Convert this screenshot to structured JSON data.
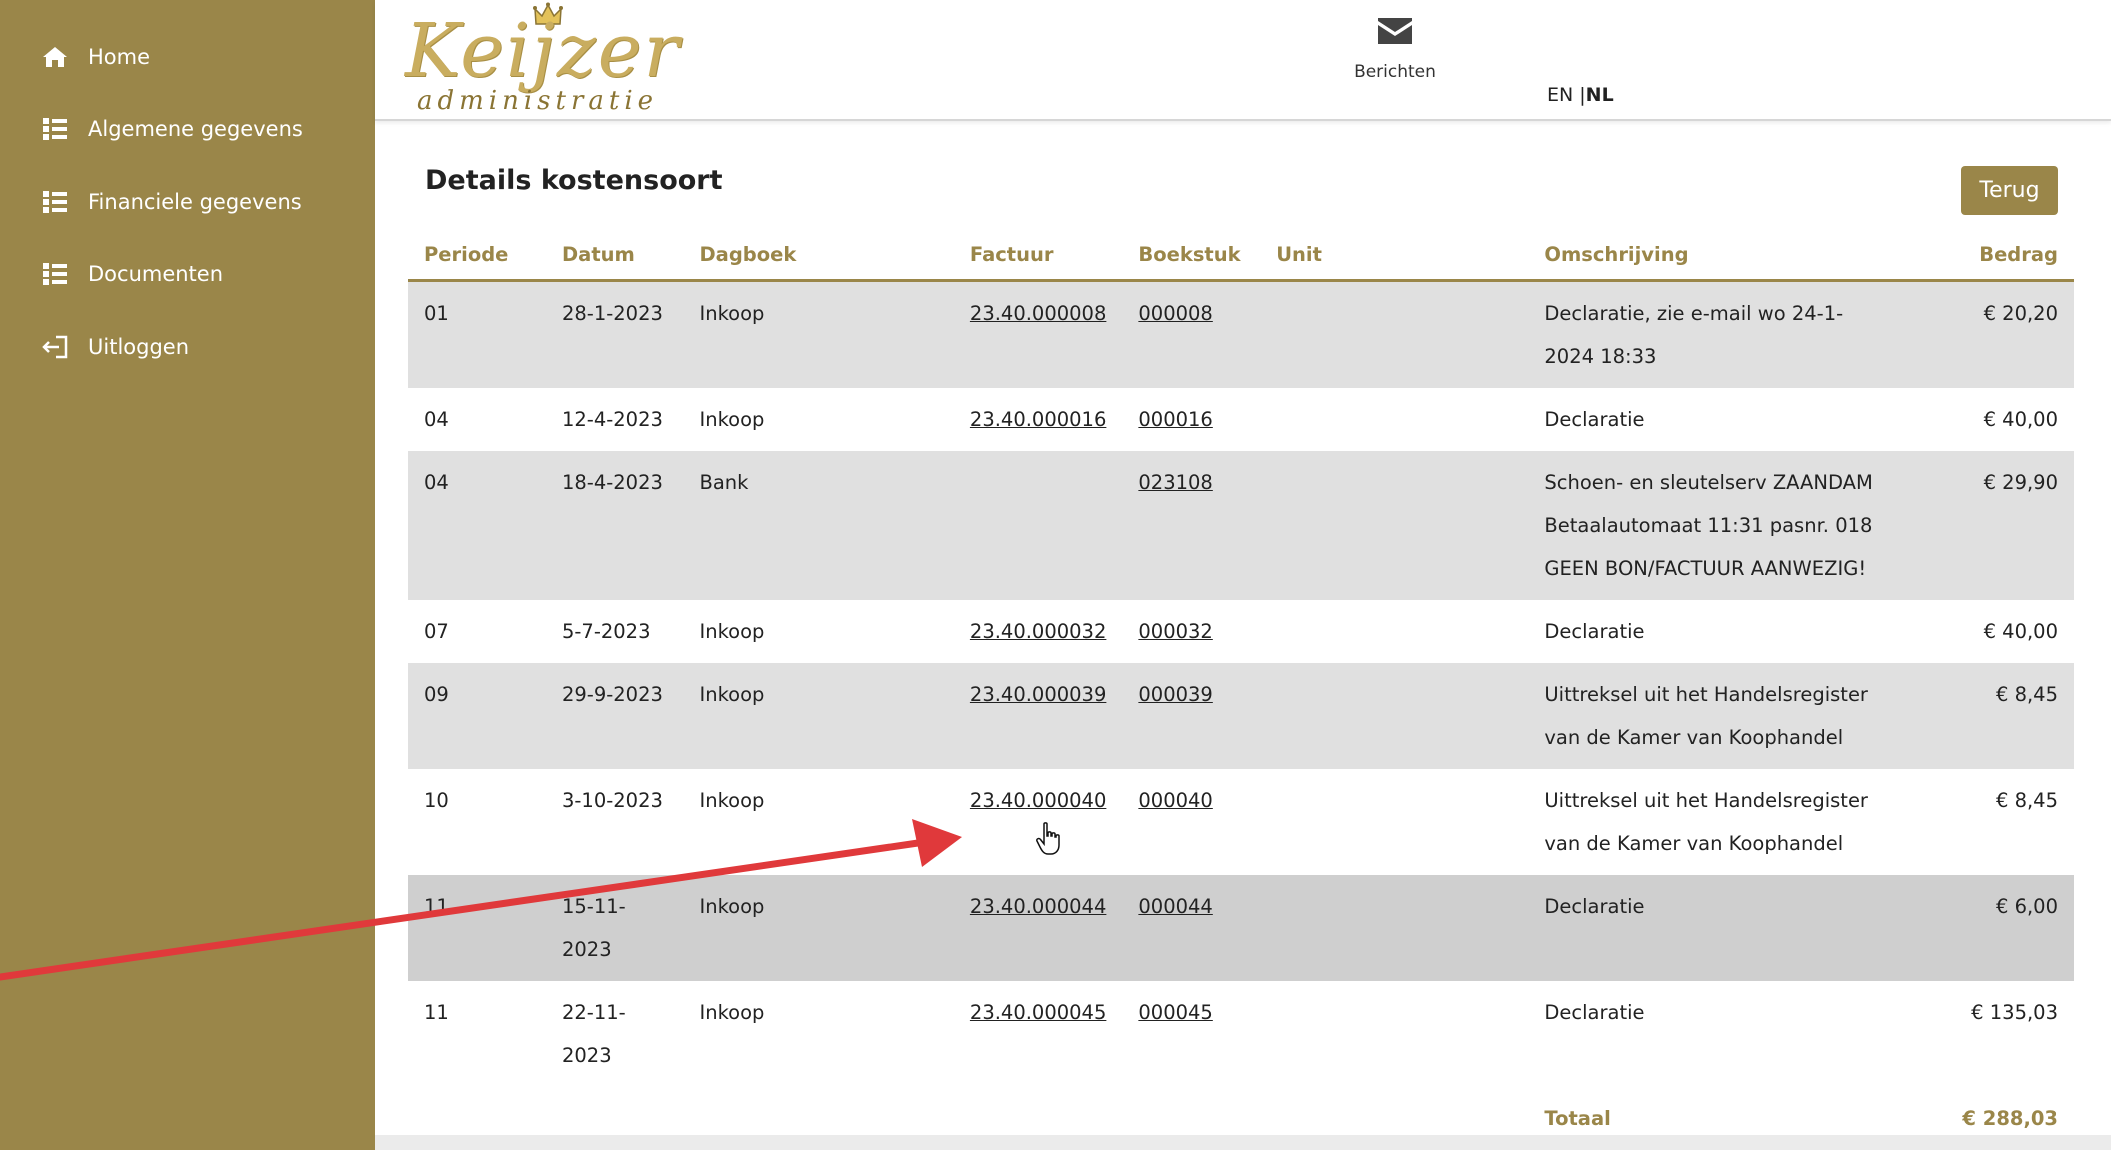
{
  "sidebar": {
    "items": [
      {
        "label": "Home",
        "icon": "home-icon"
      },
      {
        "label": "Algemene gegevens",
        "icon": "list-icon"
      },
      {
        "label": "Financiele gegevens",
        "icon": "list-icon"
      },
      {
        "label": "Documenten",
        "icon": "list-icon"
      },
      {
        "label": "Uitloggen",
        "icon": "logout-icon"
      }
    ]
  },
  "header": {
    "logo_top": "Keijzer",
    "logo_bottom": "administratie",
    "messages_label": "Berichten",
    "lang_en": "EN",
    "lang_sep": " |",
    "lang_nl": "NL"
  },
  "main": {
    "title": "Details kostensoort",
    "back_button": "Terug",
    "columns": [
      "Periode",
      "Datum",
      "Dagboek",
      "Factuur",
      "Boekstuk",
      "Unit",
      "Omschrijving",
      "Bedrag"
    ],
    "rows": [
      {
        "periode": "01",
        "datum": "28-1-2023",
        "dagboek": "Inkoop",
        "factuur": "23.40.000008",
        "boekstuk": "000008",
        "unit": "",
        "omschrijving": "Declaratie, zie e-mail wo 24-1-2024 18:33",
        "bedrag": "€ 20,20"
      },
      {
        "periode": "04",
        "datum": "12-4-2023",
        "dagboek": "Inkoop",
        "factuur": "23.40.000016",
        "boekstuk": "000016",
        "unit": "",
        "omschrijving": "Declaratie",
        "bedrag": "€ 40,00"
      },
      {
        "periode": "04",
        "datum": "18-4-2023",
        "dagboek": "Bank",
        "factuur": "",
        "boekstuk": "023108",
        "unit": "",
        "omschrijving": "Schoen- en sleutelserv ZAANDAM Betaalautomaat 11:31 pasnr. 018 GEEN BON/FACTUUR AANWEZIG!",
        "bedrag": "€ 29,90"
      },
      {
        "periode": "07",
        "datum": "5-7-2023",
        "dagboek": "Inkoop",
        "factuur": "23.40.000032",
        "boekstuk": "000032",
        "unit": "",
        "omschrijving": "Declaratie",
        "bedrag": "€ 40,00"
      },
      {
        "periode": "09",
        "datum": "29-9-2023",
        "dagboek": "Inkoop",
        "factuur": "23.40.000039",
        "boekstuk": "000039",
        "unit": "",
        "omschrijving": "Uittreksel uit het Handelsregister van de Kamer van Koophandel",
        "bedrag": "€ 8,45"
      },
      {
        "periode": "10",
        "datum": "3-10-2023",
        "dagboek": "Inkoop",
        "factuur": "23.40.000040",
        "boekstuk": "000040",
        "unit": "",
        "omschrijving": "Uittreksel uit het Handelsregister van de Kamer van Koophandel",
        "bedrag": "€ 8,45"
      },
      {
        "periode": "11",
        "datum": "15-11-2023",
        "dagboek": "Inkoop",
        "factuur": "23.40.000044",
        "boekstuk": "000044",
        "unit": "",
        "omschrijving": "Declaratie",
        "bedrag": "€ 6,00"
      },
      {
        "periode": "11",
        "datum": "22-11-2023",
        "dagboek": "Inkoop",
        "factuur": "23.40.000045",
        "boekstuk": "000045",
        "unit": "",
        "omschrijving": "Declaratie",
        "bedrag": "€ 135,03"
      }
    ],
    "total_label": "Totaal",
    "total_value": "€ 288,03"
  },
  "colors": {
    "brand": "#9a8649",
    "row_alt": "#e0e0e0",
    "row_hover": "#cfcfcf",
    "annotation_arrow": "#e0393b"
  }
}
